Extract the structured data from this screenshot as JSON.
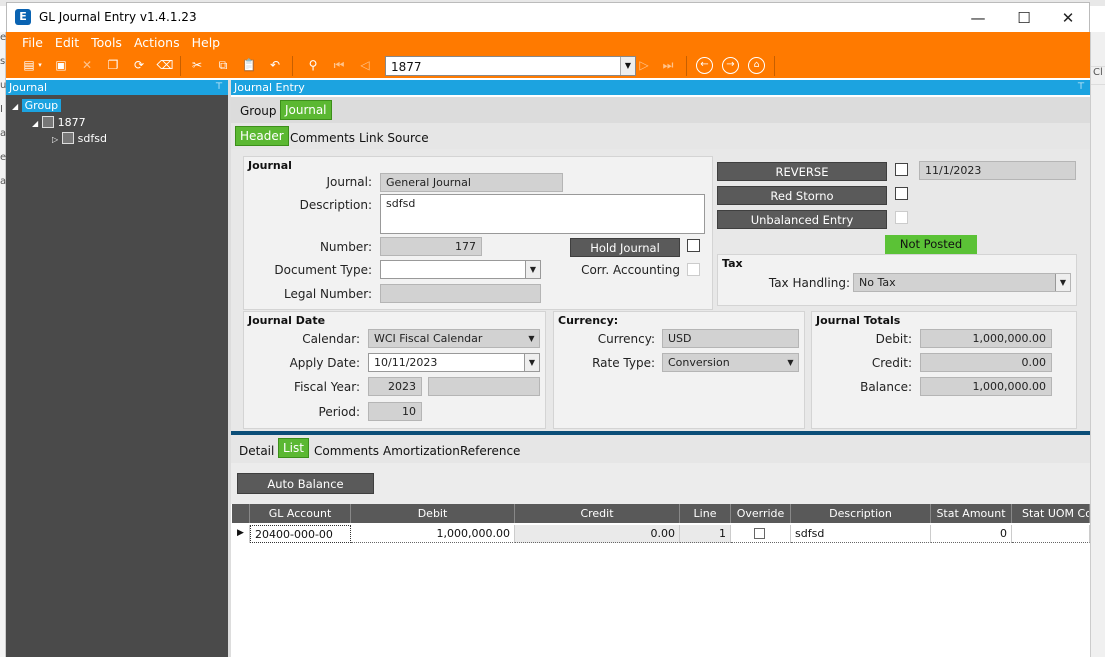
{
  "window": {
    "title": "GL Journal Entry v1.4.1.23",
    "app_icon_letter": "E",
    "minimize": "—",
    "maximize": "☐",
    "close": "✕"
  },
  "background": {
    "right_edge": [
      "Cl",
      "",
      "",
      "Cl"
    ],
    "left_edge": [
      "e",
      "s",
      "u",
      "I",
      "a",
      "e",
      "a"
    ]
  },
  "menu": [
    "File",
    "Edit",
    "Tools",
    "Actions",
    "Help"
  ],
  "toolbar": {
    "journal_selector": "1877",
    "icons": [
      "new-icon",
      "save-icon",
      "delete-icon",
      "copy-icon",
      "refresh-icon",
      "clear-icon",
      "cut-icon",
      "copy-icon",
      "paste-icon",
      "undo-icon",
      "search-icon",
      "first-icon",
      "prev-icon",
      "next-icon",
      "last-icon",
      "back-icon",
      "forward-icon",
      "home-icon"
    ]
  },
  "left_panel": {
    "title": "Journal",
    "pin": "⊤",
    "tree": [
      {
        "label": "Group",
        "level": 0,
        "selected": true
      },
      {
        "label": "1877",
        "level": 1
      },
      {
        "label": "sdfsd",
        "level": 2
      }
    ]
  },
  "main_panel": {
    "title": "Journal Entry",
    "pin": "⊤"
  },
  "top_tabs": [
    {
      "label": "Group",
      "active": false
    },
    {
      "label": "Journal",
      "active": true
    }
  ],
  "sub_tabs": [
    {
      "label": "Header",
      "active": true
    },
    {
      "label": "Comments",
      "active": false
    },
    {
      "label": "Link Source",
      "active": false
    }
  ],
  "journal": {
    "group_title": "Journal",
    "journal_label": "Journal:",
    "journal_value": "General Journal",
    "description_label": "Description:",
    "description_value": "sdfsd",
    "number_label": "Number:",
    "number_value": "177",
    "hold_journal": "Hold Journal",
    "doc_type_label": "Document Type:",
    "doc_type_value": "",
    "corr_label": "Corr. Accounting",
    "legal_number_label": "Legal Number:",
    "legal_number_value": ""
  },
  "actions": {
    "reverse": "REVERSE",
    "reverse_date": "11/1/2023",
    "red_storno": "Red Storno",
    "unbalanced": "Unbalanced Entry",
    "status": "Not Posted"
  },
  "tax": {
    "title": "Tax",
    "handling_label": "Tax Handling:",
    "handling_value": "No Tax"
  },
  "journal_date": {
    "title": "Journal Date",
    "calendar_label": "Calendar:",
    "calendar_value": "WCI Fiscal Calendar",
    "apply_label": "Apply Date:",
    "apply_value": "10/11/2023",
    "fiscal_year_label": "Fiscal Year:",
    "fiscal_year_value": "2023",
    "fiscal_year_extra": "",
    "period_label": "Period:",
    "period_value": "10"
  },
  "currency": {
    "title": "Currency:",
    "currency_label": "Currency:",
    "currency_value": "USD",
    "rate_label": "Rate Type:",
    "rate_value": "Conversion"
  },
  "totals": {
    "title": "Journal Totals",
    "debit_label": "Debit:",
    "debit_value": "1,000,000.00",
    "credit_label": "Credit:",
    "credit_value": "0.00",
    "balance_label": "Balance:",
    "balance_value": "1,000,000.00"
  },
  "lower_tabs": [
    {
      "label": "Detail",
      "active": false
    },
    {
      "label": "List",
      "active": true
    },
    {
      "label": "Comments",
      "active": false
    },
    {
      "label": "Amortization",
      "active": false
    },
    {
      "label": "Reference",
      "active": false
    }
  ],
  "auto_balance": "Auto Balance",
  "grid": {
    "columns": [
      "GL Account",
      "Debit",
      "Credit",
      "Line",
      "Override",
      "Description",
      "Stat Amount",
      "Stat UOM Co"
    ],
    "rows": [
      {
        "gl": "20400-000-00",
        "debit": "1,000,000.00",
        "credit": "0.00",
        "line": "1",
        "override": false,
        "description": "sdfsd",
        "stat_amount": "0",
        "stat_uom": ""
      }
    ]
  },
  "colors": {
    "accent_orange": "#ff7a00",
    "panel_blue": "#1ca3e0",
    "active_green": "#5bb832",
    "dark_button": "#5a5a5a"
  }
}
